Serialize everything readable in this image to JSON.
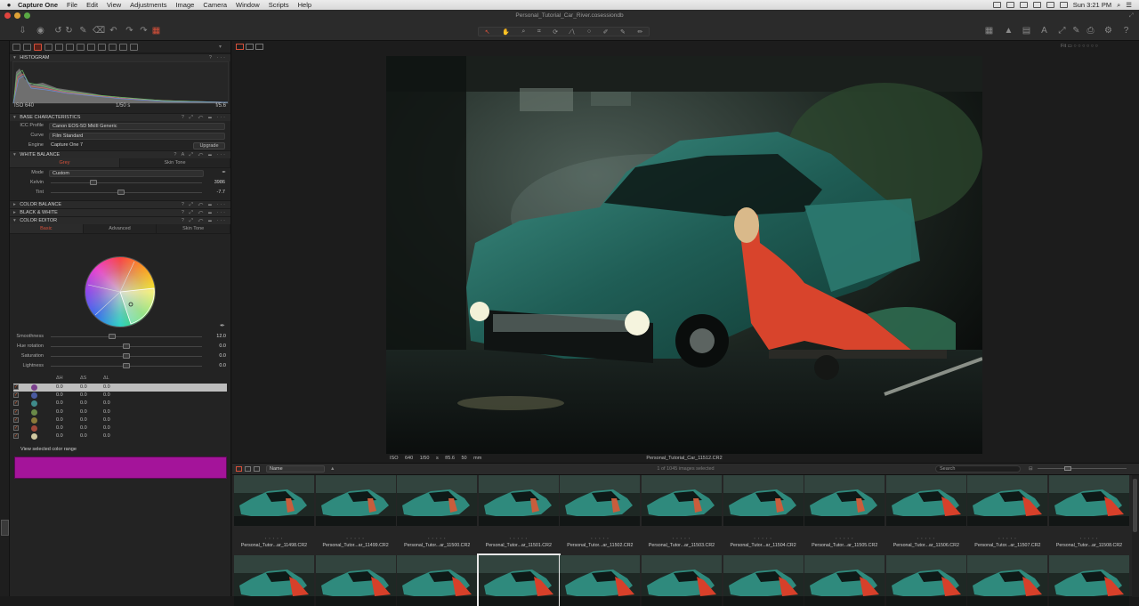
{
  "menubar": {
    "app_name": "Capture One",
    "items": [
      "File",
      "Edit",
      "View",
      "Adjustments",
      "Image",
      "Camera",
      "Window",
      "Scripts",
      "Help"
    ],
    "clock": "Sun 3:21 PM"
  },
  "window": {
    "title": "Personal_Tutorial_Car_River.cosessiondb"
  },
  "tools": {
    "histogram": {
      "title": "HISTOGRAM",
      "iso": "ISO 640",
      "shutter": "1/50 s",
      "aperture": "f/5.6"
    },
    "base": {
      "title": "BASE CHARACTERISTICS",
      "icc_label": "ICC Profile",
      "icc_value": "Canon EOS-5D MkIII Generic",
      "curve_label": "Curve",
      "curve_value": "Film Standard",
      "engine_label": "Engine",
      "engine_value": "Capture One 7",
      "upgrade_label": "Upgrade"
    },
    "white_balance": {
      "title": "WHITE BALANCE",
      "tab_grey": "Grey",
      "tab_skin": "Skin Tone",
      "mode_label": "Mode",
      "mode_value": "Custom",
      "kelvin_label": "Kelvin",
      "kelvin_value": "3986",
      "kelvin_level": 0.27,
      "tint_label": "Tint",
      "tint_value": "-7.7",
      "tint_level": 0.46
    },
    "color_balance": {
      "title": "COLOR BALANCE"
    },
    "black_white": {
      "title": "BLACK & WHITE"
    },
    "color_editor": {
      "title": "COLOR EDITOR",
      "tab_basic": "Basic",
      "tab_advanced": "Advanced",
      "tab_skin": "Skin Tone",
      "smoothness_label": "Smoothness",
      "smoothness_value": "12.0",
      "smoothness_level": 0.4,
      "hue_label": "Hue rotation",
      "hue_value": "0.0",
      "hue_level": 0.5,
      "sat_label": "Saturation",
      "sat_value": "0.0",
      "sat_level": 0.5,
      "light_label": "Lightness",
      "light_value": "0.0",
      "light_level": 0.5,
      "col_h": "ΔH",
      "col_s": "ΔS",
      "col_l": "ΔL",
      "list": [
        {
          "color": "#7a3f8c",
          "h": "0.0",
          "s": "0.0",
          "l": "0.0",
          "selected": true
        },
        {
          "color": "#4a5aa0",
          "h": "0.0",
          "s": "0.0",
          "l": "0.0",
          "selected": false
        },
        {
          "color": "#3f8a8a",
          "h": "0.0",
          "s": "0.0",
          "l": "0.0",
          "selected": false
        },
        {
          "color": "#6a8a48",
          "h": "0.0",
          "s": "0.0",
          "l": "0.0",
          "selected": false
        },
        {
          "color": "#8a7a3a",
          "h": "0.0",
          "s": "0.0",
          "l": "0.0",
          "selected": false
        },
        {
          "color": "#a0483a",
          "h": "0.0",
          "s": "0.0",
          "l": "0.0",
          "selected": false
        },
        {
          "color": "#d0c8a0",
          "h": "0.0",
          "s": "0.0",
          "l": "0.0",
          "selected": false
        }
      ],
      "view_range_label": "View selected color range",
      "range_color": "#a4149a"
    }
  },
  "viewer": {
    "meta_iso": "ISO 640",
    "meta_shutter": "1/50 s",
    "meta_aperture": "f/5.6",
    "meta_focal": "50 mm",
    "filename": "Personal_Tutorial_Car_11512.CR2"
  },
  "browser": {
    "sort_value": "Name",
    "count_label": "1 of 1045 images selected",
    "search_placeholder": "Search",
    "row1": [
      "Personal_Tutor...ar_11498.CR2",
      "Personal_Tutor...ar_11499.CR2",
      "Personal_Tutor...ar_11500.CR2",
      "Personal_Tutor...ar_11501.CR2",
      "Personal_Tutor...ar_11502.CR2",
      "Personal_Tutor...ar_11503.CR2",
      "Personal_Tutor...ar_11504.CR2",
      "Personal_Tutor...ar_11505.CR2",
      "Personal_Tutor...ar_11506.CR2",
      "Personal_Tutor...ar_11507.CR2",
      "Personal_Tutor...ar_11508.CR2"
    ]
  }
}
